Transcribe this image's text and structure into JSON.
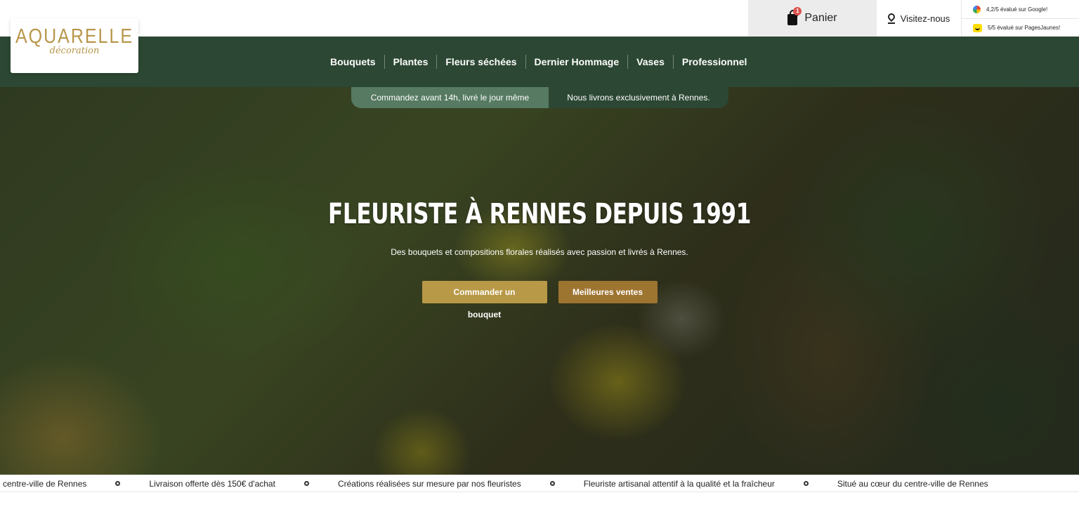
{
  "header": {
    "cart_label": "Panier",
    "cart_count": "1",
    "visit_label": "Visitez-nous",
    "ratings": [
      {
        "icon": "google-icon",
        "text": "4,2/5 évalué sur Google!"
      },
      {
        "icon": "pagesjaunes-icon",
        "text": "5/5 évalué sur PagesJaunes!"
      }
    ]
  },
  "logo": {
    "brand": "AQUARELLE",
    "sub": "décoration"
  },
  "nav": {
    "items": [
      "Bouquets",
      "Plantes",
      "Fleurs séchées",
      "Dernier Hommage",
      "Vases",
      "Professionnel"
    ]
  },
  "hero": {
    "promo_left": "Commandez avant 14h, livré le jour même",
    "promo_right": "Nous livrons exclusivement à Rennes.",
    "title": "FLEURISTE À RENNES DEPUIS 1991",
    "subtitle": "Des bouquets et compositions florales réalisés avec passion et livrés à Rennes.",
    "primary_button": "Commander un bouquet",
    "secondary_button": "Meilleures ventes"
  },
  "ticker": {
    "items": [
      "centre-ville de Rennes",
      "Livraison offerte dès 150€ d'achat",
      "Créations réalisées sur mesure par nos fleuristes",
      "Fleuriste artisanal attentif à la qualité et la fraîcheur",
      "Situé au cœur du centre-ville de Rennes"
    ]
  },
  "colors": {
    "nav_green": "#2c4733",
    "promo_green": "#567a62",
    "gold": "#b89947",
    "bronze": "#9e7431",
    "logo_gold": "#b8964a"
  }
}
